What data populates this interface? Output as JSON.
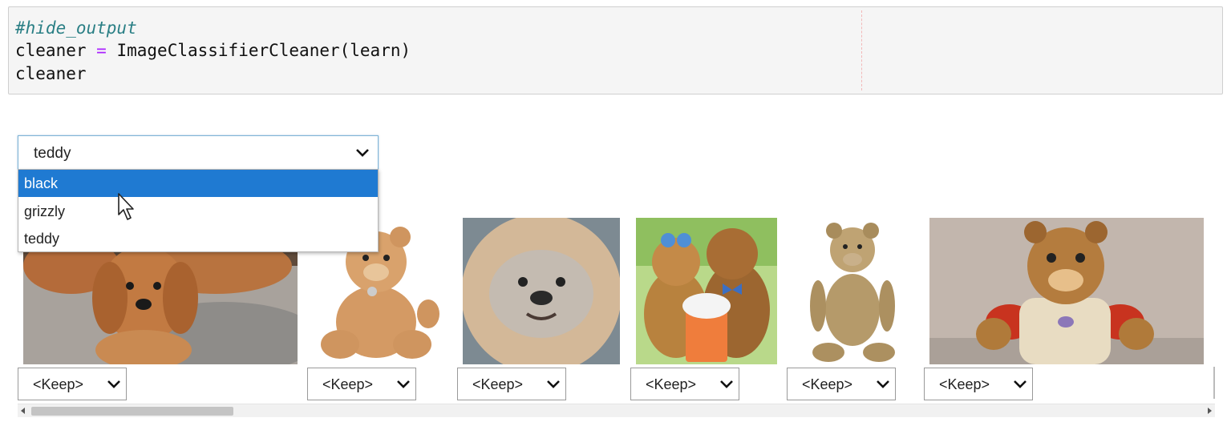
{
  "code_cell": {
    "line1": "#hide_output",
    "line2_var": "cleaner",
    "line2_op": "=",
    "line2_call": "ImageClassifierCleaner(learn)",
    "line3": "cleaner"
  },
  "category_select": {
    "value": "teddy",
    "options": [
      {
        "label": "black",
        "highlighted": true
      },
      {
        "label": "grizzly",
        "highlighted": false
      },
      {
        "label": "teddy",
        "highlighted": false
      }
    ]
  },
  "images": [
    {
      "subject": "golden puppies on grey rug"
    },
    {
      "subject": "light brown teddy bear sitting"
    },
    {
      "subject": "fluffy dog face"
    },
    {
      "subject": "two teddy bears with drink cup"
    },
    {
      "subject": "vintage tan teddy bear"
    },
    {
      "subject": "brown bear toy with red sleeves"
    }
  ],
  "keep_selects": [
    {
      "label": "<Keep>"
    },
    {
      "label": "<Keep>"
    },
    {
      "label": "<Keep>"
    },
    {
      "label": "<Keep>"
    },
    {
      "label": "<Keep>"
    },
    {
      "label": "<Keep>"
    }
  ],
  "colors": {
    "highlight": "#1f7ad2",
    "comment": "#2a7f85",
    "operator": "#aa22ff"
  }
}
